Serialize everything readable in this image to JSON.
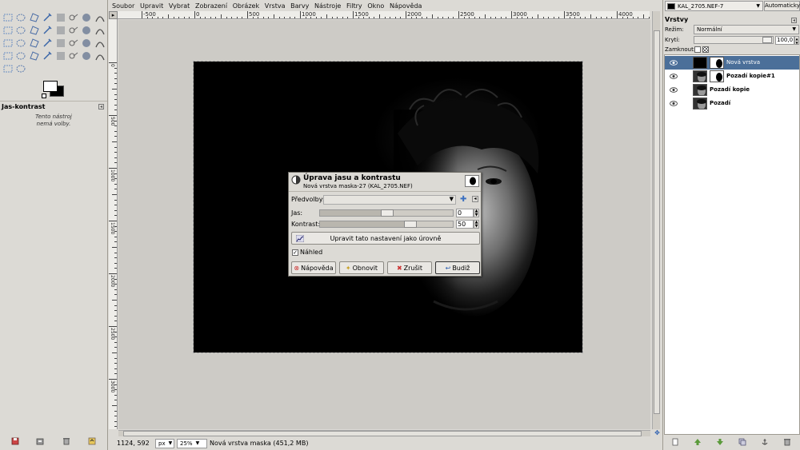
{
  "toolbox": {
    "tools": [
      "rect-select",
      "ellipse-select",
      "free-select",
      "fuzzy-select",
      "color-select",
      "scissors-select",
      "foreground-select",
      "paths",
      "color-picker",
      "zoom",
      "measure",
      "move",
      "align",
      "crop",
      "rotate",
      "scale",
      "shear",
      "perspective",
      "flip",
      "cage",
      "text",
      "bucket-fill",
      "blend",
      "pencil",
      "paintbrush",
      "eraser",
      "airbrush",
      "ink",
      "clone",
      "heal",
      "perspective-clone",
      "blur",
      "smudge",
      "dodge-burn"
    ],
    "options_title": "Jas-kontrast",
    "options_text_line1": "Tento nástroj",
    "options_text_line2": "nemá volby."
  },
  "menubar": {
    "items": [
      "Soubor",
      "Upravit",
      "Vybrat",
      "Zobrazení",
      "Obrázek",
      "Vrstva",
      "Barvy",
      "Nástroje",
      "Filtry",
      "Okno",
      "Nápověda"
    ]
  },
  "ruler": {
    "h_labels": [
      "-500",
      "0",
      "500",
      "1000",
      "1500",
      "2000",
      "2500",
      "3000",
      "3500",
      "4000"
    ],
    "v_labels": [
      "0",
      "500",
      "1000",
      "1500",
      "2000",
      "2500",
      "3000"
    ]
  },
  "statusbar": {
    "coords": "1124, 592",
    "unit": "px",
    "zoom": "25%",
    "message": "Nová vrstva maska (451,2 MB)"
  },
  "dialog": {
    "title": "Úprava jasu a kontrastu",
    "subtitle": "Nová vrstva maska-27 (KAL_2705.NEF)",
    "presets_label": "Předvolby:",
    "brightness_label": "Jas:",
    "brightness_value": "0",
    "contrast_label": "Kontrast:",
    "contrast_value": "50",
    "levels_button": "Upravit tato nastavení jako úrovně",
    "preview_label": "Náhled",
    "preview_checked": true,
    "help_button": "Nápověda",
    "reset_button": "Obnovit",
    "cancel_button": "Zrušit",
    "ok_button": "Budiž"
  },
  "layers_dock": {
    "image_name": "KAL_2705.NEF-7",
    "auto_button": "Automaticky",
    "title": "Vrstvy",
    "mode_label": "Režim:",
    "mode_value": "Normální",
    "opacity_label": "Krytí:",
    "opacity_value": "100,0",
    "lock_label": "Zamknout:",
    "layers": [
      {
        "name": "Nová vrstva",
        "selected": true,
        "has_mask": true
      },
      {
        "name": "Pozadí kopie#1",
        "selected": false,
        "has_mask": true
      },
      {
        "name": "Pozadí kopie",
        "selected": false,
        "has_mask": false
      },
      {
        "name": "Pozadí",
        "selected": false,
        "has_mask": false
      }
    ]
  },
  "colors": {
    "selection": "#4b6f99",
    "chrome": "#dcdad5",
    "canvas_bg": "#cdcbc6"
  }
}
